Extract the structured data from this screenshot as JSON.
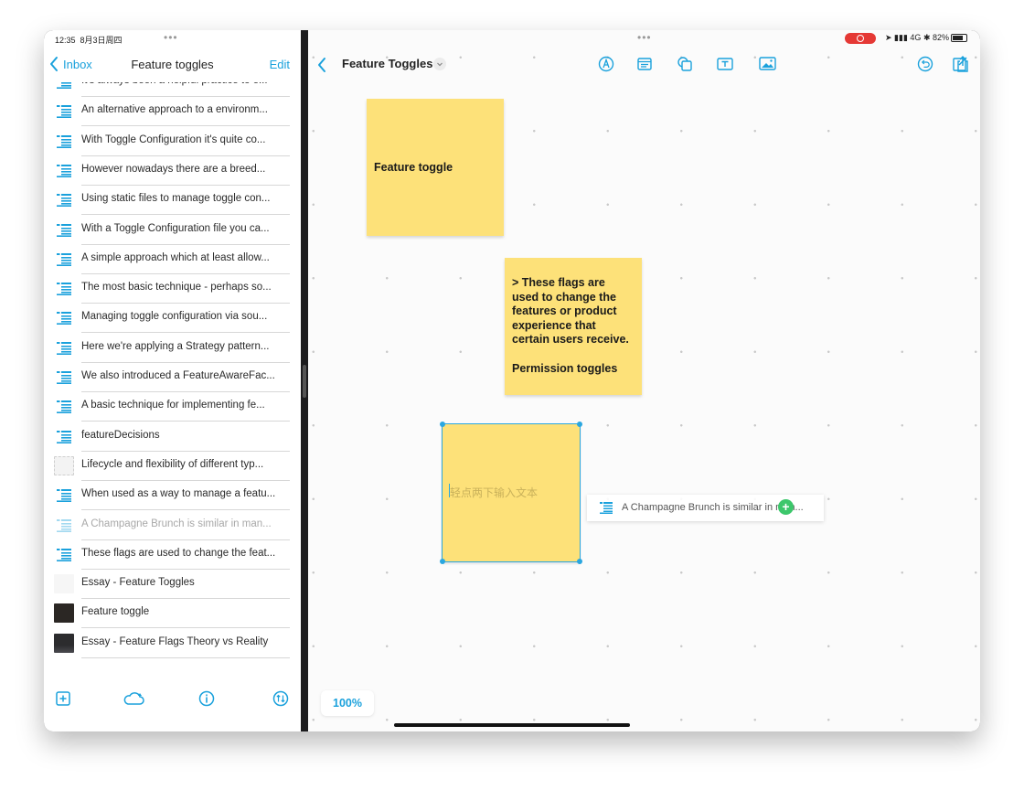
{
  "status_bar": {
    "time": "12:35",
    "date": "8月3日周四",
    "network": "4G",
    "battery": "82%"
  },
  "sidebar": {
    "back_label": "Inbox",
    "title": "Feature toggles",
    "edit_label": "Edit",
    "items": [
      {
        "label": "It's always been a helpful practice to e...",
        "kind": "note"
      },
      {
        "label": "An alternative approach to a environm...",
        "kind": "note"
      },
      {
        "label": "With Toggle Configuration it's quite co...",
        "kind": "note"
      },
      {
        "label": "However nowadays there are a breed...",
        "kind": "note"
      },
      {
        "label": "Using static files to manage toggle con...",
        "kind": "note"
      },
      {
        "label": "With a Toggle Configuration file you ca...",
        "kind": "note"
      },
      {
        "label": "A simple approach which at least allow...",
        "kind": "note"
      },
      {
        "label": "The most basic technique - perhaps so...",
        "kind": "note"
      },
      {
        "label": "Managing toggle configuration via sou...",
        "kind": "note"
      },
      {
        "label": "Here we're applying a Strategy pattern...",
        "kind": "note"
      },
      {
        "label": "We also introduced a FeatureAwareFac...",
        "kind": "note"
      },
      {
        "label": "A basic technique for implementing fe...",
        "kind": "note"
      },
      {
        "label": "featureDecisions",
        "kind": "note"
      },
      {
        "label": "Lifecycle and flexibility of different typ...",
        "kind": "image"
      },
      {
        "label": "When used as a way to manage a featu...",
        "kind": "note"
      },
      {
        "label": "A Champagne Brunch is similar in man...",
        "kind": "note-faded"
      },
      {
        "label": "These flags are used to change the feat...",
        "kind": "note"
      },
      {
        "label": "Essay - Feature Toggles",
        "kind": "blank"
      },
      {
        "label": "Feature toggle",
        "kind": "dark-thumb"
      },
      {
        "label": "Essay - Feature Flags Theory vs Reality",
        "kind": "screenshot-thumb"
      }
    ]
  },
  "canvas": {
    "title": "Feature Toggles",
    "zoom_label": "100%",
    "stickies": [
      {
        "text": "Feature toggle"
      },
      {
        "text": "> These flags are used to change the features or product experience that certain users receive.\n\nPermission toggles"
      },
      {
        "text": "",
        "placeholder": "轻点两下输入文本"
      }
    ],
    "drag_card_label": "A Champagne Brunch is similar in man...",
    "drag_add_symbol": "+"
  },
  "colors": {
    "accent": "#1aa1dc",
    "sticky": "#fde179",
    "selection": "#2aa7e0",
    "add_badge": "#3cc76b"
  }
}
